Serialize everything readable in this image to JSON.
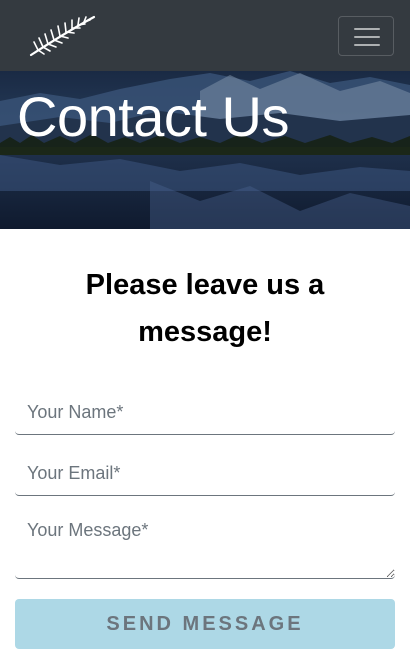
{
  "navbar": {
    "logo_icon": "silver-fern-icon",
    "menu_icon": "hamburger-icon"
  },
  "hero": {
    "title": "Contact Us"
  },
  "form": {
    "heading": "Please leave us a message!",
    "name_placeholder": "Your Name*",
    "email_placeholder": "Your Email*",
    "message_placeholder": "Your Message*",
    "send_label": "SEND MESSAGE"
  },
  "colors": {
    "navbar_bg": "#343a40",
    "button_bg": "#add8e6",
    "button_text": "#6c757d"
  }
}
